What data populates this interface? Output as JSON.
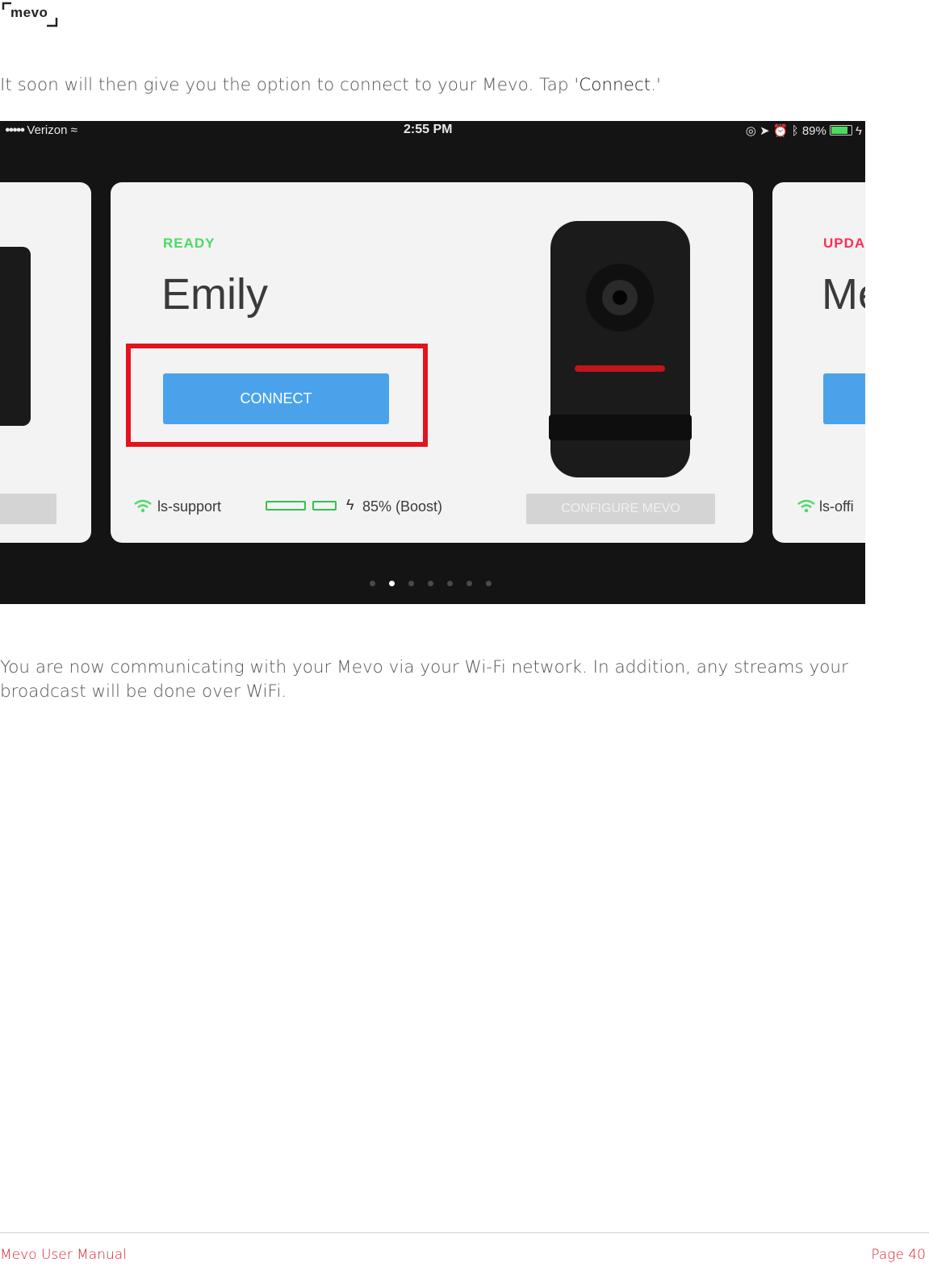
{
  "logo": {
    "text": "mevo"
  },
  "intro": {
    "text": "It soon will then give you the option to connect to your Mevo. Tap '",
    "emphasis": "Connect",
    "suffix": ".'"
  },
  "screenshot": {
    "statusbar": {
      "carrier": "Verizon",
      "time": "2:55 PM",
      "battery": "89%"
    },
    "cards": [
      {
        "status": "READY",
        "name": "Emily",
        "button": "CONNECT",
        "network": "ls-support",
        "charge": "85% (Boost)",
        "secondary_button": "CONFIGURE MEVO"
      },
      {
        "status": "UPDA",
        "name": "Me",
        "network": "ls-offi"
      }
    ],
    "colors": {
      "ready": "#4cd964",
      "update": "#ff2d55",
      "button": "#4aa3ea",
      "highlight": "#e3141b"
    },
    "pager": {
      "count": 7,
      "active": 1
    }
  },
  "outro": {
    "text": "You are now communicating with your Mevo via your Wi-Fi network. In addition, any streams your broadcast will be done over WiFi."
  },
  "footer": {
    "left": "Mevo User Manual",
    "right": "Page 40"
  }
}
